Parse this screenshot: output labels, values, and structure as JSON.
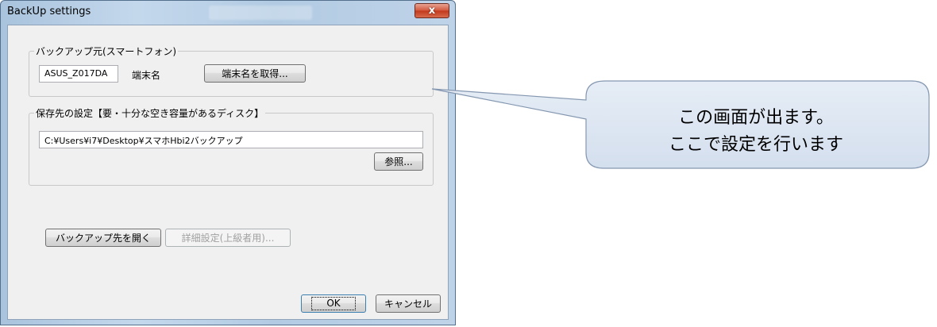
{
  "window": {
    "title": "BackUp settings",
    "close_glyph": "x"
  },
  "source_group": {
    "label": "バックアップ元(スマートフォン)",
    "device_name_value": "ASUS_Z017DA",
    "device_name_label": "端末名",
    "get_device_name_button": "端末名を取得..."
  },
  "dest_group": {
    "label": "保存先の設定【要・十分な空き容量があるディスク】",
    "path_value": "C:¥Users¥i7¥Desktop¥スマホHbi2バックアップ",
    "browse_button": "参照..."
  },
  "actions": {
    "open_backup_dest_button": "バックアップ先を開く",
    "advanced_button": "詳細設定(上級者用)...",
    "ok_button": "OK",
    "cancel_button": "キャンセル"
  },
  "callout": {
    "line1": "この画面が出ます。",
    "line2": "ここで設定を行います",
    "fill_color": "#dce6f2",
    "stroke_color": "#8497b0"
  }
}
